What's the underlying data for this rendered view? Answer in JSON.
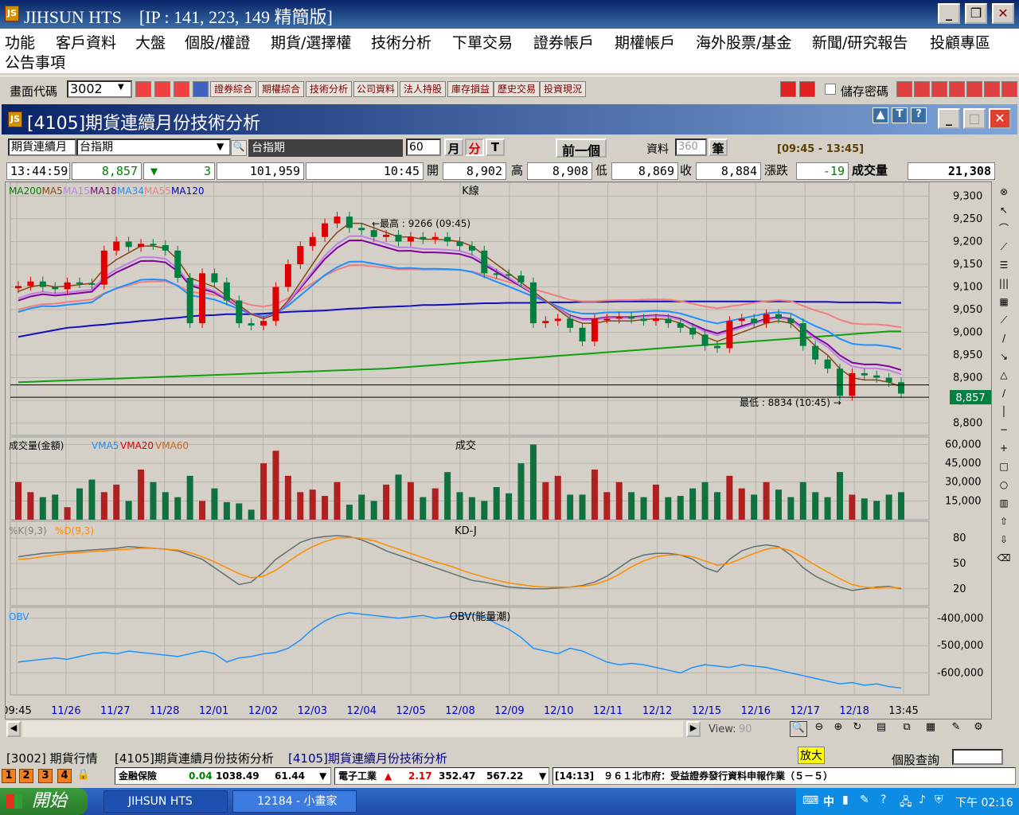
{
  "window": {
    "title": "JIHSUN HTS　[IP : 141, 223, 149 精簡版]"
  },
  "menu": [
    "功能",
    "客戶資料",
    "大盤",
    "個股/權證",
    "期貨/選擇權",
    "技術分析",
    "下單交易",
    "證券帳戶",
    "期權帳戶",
    "海外股票/基金",
    "新聞/研究報告",
    "投顧專區",
    "公告事項"
  ],
  "toolbar": {
    "code_label": "畫面代碼",
    "code_value": "3002",
    "buttons": [
      "證券綜合",
      "期權綜合",
      "技術分析",
      "公司資料",
      "法人持股",
      "庫存損益",
      "歷史交易",
      "投資現況"
    ],
    "save_password": "儲存密碼"
  },
  "child": {
    "title": "[4105]期貨連續月份技術分析"
  },
  "controls": {
    "product_type": "期貨連續月",
    "product": "台指期",
    "product_name": "台指期",
    "period": "60",
    "month": "月",
    "minute": "分",
    "tick": "T",
    "prev": "前一個",
    "data_label": "資料",
    "data_count": "360",
    "unit": "筆",
    "time_range": "[09:45 - 13:45]"
  },
  "quote": {
    "time": "13:44:59",
    "price": "8,857",
    "change": "3",
    "volume_total": "101,959",
    "bar_time": "10:45",
    "open_label": "開",
    "open": "8,902",
    "high_label": "高",
    "high": "8,908",
    "low_label": "低",
    "low": "8,869",
    "close_label": "收",
    "close": "8,884",
    "chg_label": "漲跌",
    "chg": "-19",
    "vol_label": "成交量",
    "vol": "21,308"
  },
  "panels": {
    "kline": {
      "title": "K線",
      "legend": [
        {
          "name": "MA200",
          "color": "#008000"
        },
        {
          "name": "MA5",
          "color": "#8b4513"
        },
        {
          "name": "MA15",
          "color": "#c080e0"
        },
        {
          "name": "MA18",
          "color": "#800080"
        },
        {
          "name": "MA34",
          "color": "#1e90ff"
        },
        {
          "name": "MA55",
          "color": "#f08080"
        },
        {
          "name": "MA120",
          "color": "#0000c0"
        }
      ],
      "high_note": "最高 : 9266 (09:45)",
      "low_note": "最低 : 8834 (10:45)",
      "last_price": "8,857",
      "yticks": [
        "9,300",
        "9,250",
        "9,200",
        "9,150",
        "9,100",
        "9,050",
        "9,000",
        "8,950",
        "8,900",
        "8,850",
        "8,800"
      ]
    },
    "volume": {
      "title": "成交",
      "label": "成交量(金額)",
      "legend": [
        {
          "name": "VMA5",
          "color": "#1e90ff"
        },
        {
          "name": "VMA20",
          "color": "#e00000"
        },
        {
          "name": "VMA60",
          "color": "#d2691e"
        }
      ],
      "yticks": [
        "60,000",
        "45,000",
        "30,000",
        "15,000"
      ]
    },
    "kd": {
      "title": "KD-J",
      "legend": [
        {
          "name": "%K(9,3)",
          "color": "#808080"
        },
        {
          "name": "%D(9,3)",
          "color": "#ff8c00"
        }
      ],
      "yticks": [
        "80",
        "50",
        "20"
      ]
    },
    "obv": {
      "title": "OBV(能量潮)",
      "legend": [
        {
          "name": "OBV",
          "color": "#1e90ff"
        }
      ],
      "yticks": [
        "-400,000",
        "-500,000",
        "-600,000"
      ]
    }
  },
  "xaxis": [
    "09:45",
    "11/26",
    "11/27",
    "11/28",
    "12/01",
    "12/02",
    "12/03",
    "12/04",
    "12/05",
    "12/08",
    "12/09",
    "12/10",
    "12/11",
    "12/12",
    "12/15",
    "12/16",
    "12/17",
    "12/18",
    "13:45"
  ],
  "view": {
    "label": "View:",
    "value": "90"
  },
  "tabs": [
    "[3002] 期貨行情",
    "[4105]期貨連續月份技術分析",
    "[4105]期貨連續月份技術分析"
  ],
  "zoom": "放大",
  "stock_query": "個股查詢",
  "status": {
    "pages": [
      "1",
      "2",
      "3",
      "4"
    ],
    "sector1": "金融保險",
    "s1_chg": "0.04",
    "s1_idx": "1038.49",
    "s1_val": "61.44",
    "sector2": "電子工業",
    "s2_chg": "2.17",
    "s2_idx": "352.47",
    "s2_val": "567.22",
    "news": "[14:13]　９６１北市府：受益證券發行資料申報作業（５－５）"
  },
  "taskbar": {
    "start": "開始",
    "tasks": [
      "JIHSUN HTS",
      "12184 - 小畫家"
    ],
    "clock": "下午 02:16",
    "ime": "中"
  },
  "colors": {
    "up": "#e00000",
    "down": "#008040",
    "accent": "#0a246a"
  },
  "chart_data": [
    {
      "type": "candlestick",
      "title": "K線",
      "x_axis_labels": [
        "09:45",
        "11/26",
        "11/27",
        "11/28",
        "12/01",
        "12/02",
        "12/03",
        "12/04",
        "12/05",
        "12/08",
        "12/09",
        "12/10",
        "12/11",
        "12/12",
        "12/15",
        "12/16",
        "12/17",
        "12/18",
        "13:45"
      ],
      "ylim": [
        8780,
        9320
      ],
      "close": [
        9102,
        9112,
        9100,
        9095,
        9110,
        9108,
        9105,
        9180,
        9200,
        9188,
        9195,
        9192,
        9180,
        9120,
        9020,
        9130,
        9110,
        9070,
        9020,
        9015,
        9025,
        9100,
        9150,
        9190,
        9210,
        9240,
        9255,
        9230,
        9225,
        9210,
        9215,
        9200,
        9210,
        9205,
        9210,
        9200,
        9190,
        9180,
        9130,
        9128,
        9125,
        9110,
        9020,
        9025,
        9030,
        9010,
        8980,
        9030,
        9030,
        9035,
        9030,
        9025,
        9030,
        9020,
        9010,
        8995,
        8970,
        8965,
        9025,
        9030,
        9020,
        9040,
        9030,
        9020,
        8970,
        8940,
        8920,
        8860,
        8910,
        8905,
        8900,
        8890,
        8865
      ],
      "ma5": [
        9090,
        9100,
        9105,
        9100,
        9102,
        9105,
        9108,
        9140,
        9160,
        9175,
        9190,
        9190,
        9185,
        9160,
        9120,
        9110,
        9100,
        9080,
        9060,
        9040,
        9030,
        9040,
        9070,
        9110,
        9150,
        9190,
        9220,
        9240,
        9240,
        9230,
        9220,
        9210,
        9210,
        9205,
        9205,
        9203,
        9200,
        9190,
        9170,
        9150,
        9130,
        9110,
        9090,
        9070,
        9050,
        9030,
        9020,
        9020,
        9025,
        9025,
        9025,
        9028,
        9030,
        9028,
        9020,
        9005,
        8990,
        8980,
        8990,
        9000,
        9010,
        9020,
        9025,
        9020,
        8995,
        8970,
        8950,
        8920,
        8900,
        8895,
        8895,
        8890,
        8880
      ],
      "ma120": [
        8990,
        8995,
        9000,
        9005,
        9010,
        9012,
        9015,
        9017,
        9020,
        9022,
        9025,
        9027,
        9030,
        9032,
        9035,
        9037,
        9038,
        9040,
        9040,
        9040,
        9041,
        9043,
        9045,
        9046,
        9047,
        9048,
        9050,
        9052,
        9053,
        9055,
        9056,
        9057,
        9058,
        9060,
        9060,
        9061,
        9062,
        9063,
        9064,
        9064,
        9065,
        9065,
        9065,
        9066,
        9066,
        9066,
        9067,
        9067,
        9067,
        9068,
        9068,
        9068,
        9068,
        9068,
        9068,
        9068,
        9068,
        9068,
        9068,
        9068,
        9068,
        9068,
        9068,
        9068,
        9067,
        9067,
        9067,
        9066,
        9066,
        9066,
        9066,
        9065,
        9065
      ],
      "ma200": [
        8890,
        8891,
        8892,
        8893,
        8894,
        8895,
        8896,
        8897,
        8898,
        8899,
        8900,
        8901,
        8902,
        8903,
        8904,
        8905,
        8906,
        8907,
        8908,
        8909,
        8910,
        8911,
        8912,
        8913,
        8914,
        8915,
        8916,
        8917,
        8918,
        8919,
        8920,
        8922,
        8924,
        8926,
        8928,
        8930,
        8932,
        8934,
        8936,
        8938,
        8940,
        8942,
        8944,
        8946,
        8948,
        8950,
        8952,
        8954,
        8956,
        8958,
        8960,
        8962,
        8964,
        8966,
        8968,
        8970,
        8972,
        8974,
        8976,
        8978,
        8980,
        8982,
        8984,
        8986,
        8988,
        8990,
        8992,
        8994,
        8996,
        8998,
        9000,
        9002,
        9002
      ]
    },
    {
      "type": "bar",
      "title": "成交",
      "values": [
        30000,
        22000,
        18000,
        20000,
        10000,
        25000,
        32000,
        22000,
        28000,
        15000,
        40000,
        30000,
        22000,
        18000,
        35000,
        15000,
        25000,
        14000,
        13000,
        8000,
        45000,
        55000,
        35000,
        22000,
        24000,
        19000,
        30000,
        12000,
        20000,
        15000,
        28000,
        36000,
        30000,
        18000,
        25000,
        38000,
        22000,
        18000,
        15000,
        26000,
        21000,
        45000,
        60000,
        30000,
        35000,
        20000,
        20000,
        40000,
        22000,
        30000,
        22000,
        18000,
        28000,
        18000,
        19000,
        25000,
        30000,
        22000,
        35000,
        25000,
        20000,
        30000,
        24000,
        18000,
        30000,
        22000,
        18000,
        38000,
        20000,
        17000,
        15000,
        20000,
        22000
      ]
    },
    {
      "type": "line",
      "title": "KD-J",
      "series": [
        {
          "name": "%K(9,3)",
          "values": [
            58,
            60,
            62,
            63,
            64,
            65,
            66,
            67,
            68,
            70,
            69,
            68,
            67,
            65,
            60,
            55,
            45,
            35,
            25,
            28,
            40,
            55,
            65,
            75,
            80,
            82,
            83,
            82,
            78,
            72,
            65,
            60,
            55,
            50,
            45,
            40,
            35,
            30,
            28,
            25,
            22,
            21,
            20,
            20,
            21,
            22,
            24,
            28,
            35,
            45,
            55,
            60,
            62,
            62,
            60,
            55,
            45,
            40,
            55,
            65,
            70,
            72,
            70,
            60,
            45,
            35,
            28,
            22,
            18,
            20,
            22,
            23,
            20
          ]
        },
        {
          "name": "%D(9,3)",
          "values": [
            55,
            56,
            58,
            60,
            62,
            63,
            64,
            65,
            66,
            67,
            68,
            68,
            67,
            66,
            63,
            58,
            52,
            45,
            38,
            33,
            35,
            42,
            52,
            62,
            70,
            76,
            80,
            81,
            80,
            77,
            72,
            67,
            62,
            57,
            52,
            48,
            43,
            38,
            34,
            30,
            27,
            25,
            23,
            22,
            22,
            22,
            23,
            25,
            30,
            37,
            46,
            53,
            58,
            60,
            60,
            58,
            53,
            48,
            50,
            56,
            62,
            67,
            69,
            65,
            57,
            48,
            40,
            32,
            25,
            22,
            21,
            22,
            21
          ]
        }
      ]
    },
    {
      "type": "line",
      "title": "OBV(能量潮)",
      "series": [
        {
          "name": "OBV",
          "values": [
            -560000,
            -555000,
            -550000,
            -545000,
            -550000,
            -540000,
            -530000,
            -525000,
            -530000,
            -520000,
            -525000,
            -530000,
            -535000,
            -540000,
            -530000,
            -520000,
            -530000,
            -560000,
            -545000,
            -540000,
            -530000,
            -525000,
            -510000,
            -480000,
            -440000,
            -410000,
            -390000,
            -380000,
            -385000,
            -390000,
            -395000,
            -400000,
            -395000,
            -390000,
            -400000,
            -395000,
            -390000,
            -385000,
            -395000,
            -420000,
            -440000,
            -470000,
            -510000,
            -520000,
            -530000,
            -510000,
            -520000,
            -540000,
            -560000,
            -570000,
            -565000,
            -570000,
            -580000,
            -590000,
            -600000,
            -580000,
            -570000,
            -575000,
            -580000,
            -570000,
            -575000,
            -580000,
            -590000,
            -600000,
            -610000,
            -620000,
            -630000,
            -640000,
            -635000,
            -645000,
            -640000,
            -650000,
            -655000
          ]
        }
      ]
    }
  ]
}
